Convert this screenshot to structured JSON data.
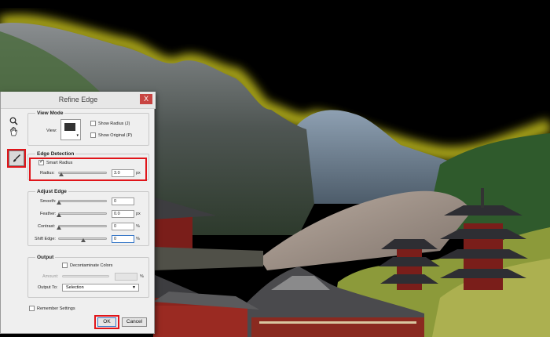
{
  "dialog": {
    "title": "Refine Edge",
    "close_label": "X"
  },
  "view_mode": {
    "heading": "View Mode",
    "view_label": "View:",
    "show_radius": "Show Radius (J)",
    "show_original": "Show Original (P)"
  },
  "edge_detection": {
    "heading": "Edge Detection",
    "smart_radius_label": "Smart Radius",
    "smart_radius_checked": true,
    "radius_label": "Radius:",
    "radius_value": "3.0",
    "radius_unit": "px",
    "radius_fraction": 0.05
  },
  "adjust_edge": {
    "heading": "Adjust Edge",
    "smooth_label": "Smooth:",
    "smooth_value": "0",
    "feather_label": "Feather:",
    "feather_value": "0.0",
    "feather_unit": "px",
    "contrast_label": "Contrast:",
    "contrast_value": "0",
    "contrast_unit": "%",
    "shift_label": "Shift Edge:",
    "shift_value": "0",
    "shift_unit": "%",
    "shift_fraction": 0.5
  },
  "output": {
    "heading": "Output",
    "decontaminate_label": "Decontaminate Colors",
    "amount_label": "Amount:",
    "amount_unit": "%",
    "output_to_label": "Output To:",
    "output_to_value": "Selection"
  },
  "remember_label": "Remember Settings",
  "buttons": {
    "ok": "OK",
    "cancel": "Cancel"
  },
  "colors": {
    "highlight": "#e0151a",
    "edge_glow": "#c8c21e"
  },
  "icons": {
    "zoom": "zoom-tool-icon",
    "hand": "hand-tool-icon",
    "brush": "refine-radius-brush-icon"
  }
}
